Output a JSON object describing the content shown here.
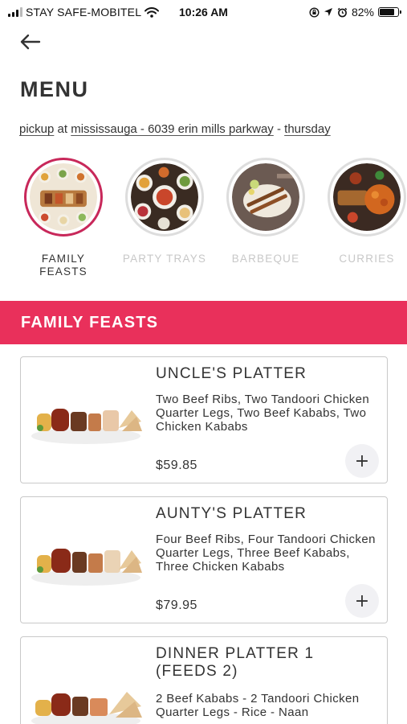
{
  "status_bar": {
    "carrier": "STAY SAFE-MOBITEL",
    "time": "10:26 AM",
    "battery_text": "82%",
    "battery_level": 0.82
  },
  "header": {
    "title": "MENU",
    "pickup": {
      "mode": "pickup",
      "at": "at",
      "location": "mississauga - 6039 erin mills parkway",
      "separator": "-",
      "day": "thursday"
    }
  },
  "categories": [
    {
      "label": "FAMILY FEASTS",
      "active": true
    },
    {
      "label": "PARTY TRAYS",
      "active": false
    },
    {
      "label": "BARBEQUE",
      "active": false
    },
    {
      "label": "CURRIES",
      "active": false
    }
  ],
  "section": {
    "title": "FAMILY FEASTS"
  },
  "items": [
    {
      "name": "UNCLE'S PLATTER",
      "description": "Two Beef Ribs, Two Tandoori Chicken Quarter Legs, Two Beef Kababs, Two Chicken Kababs",
      "price": "$59.85",
      "add_label": "+"
    },
    {
      "name": "AUNTY'S PLATTER",
      "description": "Four Beef Ribs, Four Tandoori Chicken Quarter Legs, Three Beef Kababs, Three Chicken Kababs",
      "price": "$79.95",
      "add_label": "+"
    },
    {
      "name": "DINNER PLATTER 1 (FEEDS 2)",
      "description": "2 Beef Kababs - 2 Tandoori Chicken Quarter Legs - Rice - Naan",
      "price": "",
      "add_label": "+"
    }
  ],
  "icons": {
    "back": "arrow-left-icon",
    "add": "plus-icon",
    "wifi": "wifi-icon",
    "battery": "battery-icon"
  },
  "colors": {
    "accent": "#e9305b",
    "active_ring": "#c8285a",
    "inactive_label": "#c8c8c8"
  }
}
